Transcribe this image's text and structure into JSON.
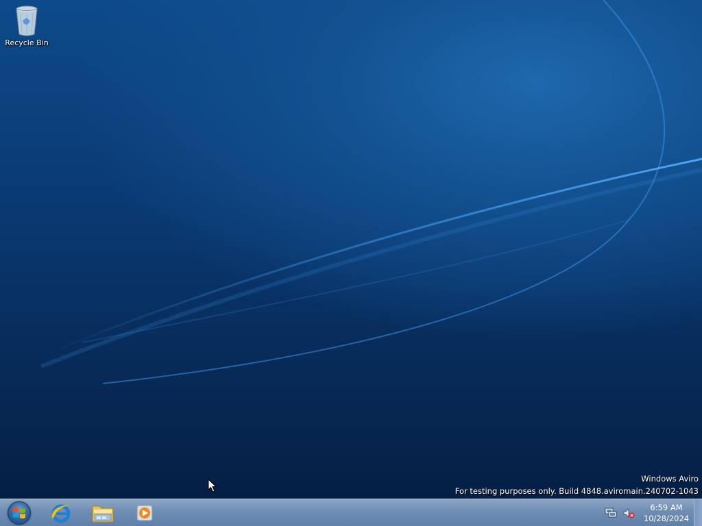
{
  "desktop": {
    "icons": [
      {
        "label": "Recycle Bin",
        "icon": "recycle-bin-icon"
      }
    ],
    "watermark": {
      "line1": "Windows Aviro",
      "line2": "For testing purposes only. Build 4848.aviromain.240702-1043"
    }
  },
  "taskbar": {
    "start": {
      "icon": "windows-logo-icon"
    },
    "pinned": [
      {
        "icon": "internet-explorer-icon"
      },
      {
        "icon": "file-explorer-icon"
      },
      {
        "icon": "media-player-icon"
      }
    ],
    "tray": {
      "icons": [
        "network-icon",
        "volume-muted-icon"
      ],
      "time": "6:59 AM",
      "date": "10/28/2024"
    }
  },
  "colors": {
    "desktop_top": "#0d4a8a",
    "desktop_bottom": "#051f44",
    "taskbar": "#6f8db3"
  }
}
